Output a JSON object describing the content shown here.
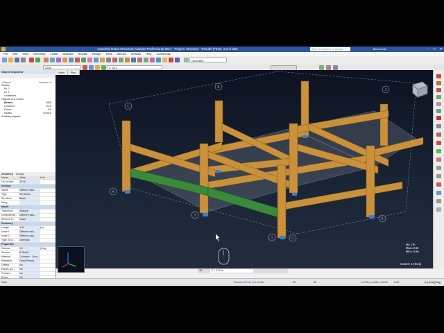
{
  "app": {
    "title": "Autodesk Robot Structural Analysis Professional 2017 - Project: Structure - Results (FEM): out of date",
    "search_placeholder": "Type a keyword or phrase",
    "user": "Benvenuto",
    "menu": [
      "File",
      "Edit",
      "View",
      "Geometry",
      "Loads",
      "Analysis",
      "Results",
      "Design",
      "Tools",
      "Add-ins",
      "Window",
      "Help",
      "Community"
    ]
  },
  "toolbar": {
    "bar_value": "2930",
    "case_value": "1: DL1",
    "layout_value": "Geometry"
  },
  "inspector": {
    "title": "Object Inspector",
    "col_objects": "Objects",
    "col_number": "Number of...",
    "tree": [
      {
        "label": "Stories",
        "count": ""
      },
      {
        "label": "Ex 2",
        "count": ""
      },
      {
        "label": "Ex 1",
        "count": ""
      },
      {
        "label": "Undefined",
        "count": ""
      },
      {
        "label": "Objects of a model",
        "count": ""
      },
      {
        "label": "Beams",
        "count": "2/12"
      },
      {
        "label": "Columns",
        "count": "0/15"
      },
      {
        "label": "Floors",
        "count": "0/4"
      },
      {
        "label": "Nodes",
        "count": "0/2015"
      },
      {
        "label": "Auxiliary objects",
        "count": ""
      }
    ],
    "tabs": [
      "Geometry",
      "Groups"
    ],
    "props_header": {
      "name": "Name",
      "value": "Value",
      "unit": "Unit"
    },
    "props": [
      {
        "name": "List of bars",
        "value": "29 30",
        "unit": "",
        "section": false
      },
      {
        "name": "General",
        "value": "",
        "unit": "",
        "section": true
      },
      {
        "name": "Name",
        "value": "Different valu...",
        "unit": "",
        "section": false
      },
      {
        "name": "Type",
        "value": "RC Beam",
        "unit": "",
        "section": false
      },
      {
        "name": "Structure...",
        "value": "Beam",
        "unit": "",
        "section": false
      },
      {
        "name": "Story",
        "value": "",
        "unit": "",
        "section": false
      },
      {
        "name": "Model",
        "value": "",
        "unit": "",
        "section": true
      },
      {
        "name": "Trapezoid...",
        "value": "Analyze",
        "unit": "",
        "section": false
      },
      {
        "name": "components...",
        "value": "Different valu...",
        "unit": "",
        "section": false
      },
      {
        "name": "Element ty...",
        "value": "beam",
        "unit": "",
        "section": false
      },
      {
        "name": "Geometry",
        "value": "",
        "unit": "",
        "section": true
      },
      {
        "name": "Length",
        "value": "5.00",
        "unit": "(m)",
        "section": false
      },
      {
        "name": "Node 1",
        "value": "Different valu...",
        "unit": "",
        "section": false
      },
      {
        "name": "Node 2",
        "value": "Different valu...",
        "unit": "",
        "section": false
      },
      {
        "name": "Type of co...",
        "value": "cartesian",
        "unit": "",
        "section": false
      },
      {
        "name": "Properties",
        "value": "",
        "unit": "",
        "section": true
      },
      {
        "name": "Gamma",
        "value": "0.0",
        "unit": "(Deg)",
        "section": false
      },
      {
        "name": "Section",
        "value": "B 30x40",
        "unit": "",
        "section": false
      },
      {
        "name": "Material",
        "value": "Concrete - Conc...",
        "unit": "",
        "section": false
      },
      {
        "name": "Releases",
        "value": "Fixed-Pinned",
        "unit": "",
        "section": false
      },
      {
        "name": "Offsets",
        "value": "No",
        "unit": "",
        "section": false
      },
      {
        "name": "Elastic gro...",
        "value": "No",
        "unit": "",
        "section": false
      },
      {
        "name": "Precam...",
        "value": "No",
        "unit": "",
        "section": false
      },
      {
        "name": "Brace...",
        "value": "No",
        "unit": "",
        "section": false
      }
    ]
  },
  "viewport": {
    "tabs": [
      "View",
      "Plan"
    ],
    "grid_labels": [
      "C",
      "B",
      "2",
      "A",
      "2",
      "1",
      "3",
      "C",
      "B"
    ],
    "legend": [
      "My  1Te",
      "Max=3.62",
      "Min=-3.55"
    ],
    "cases": "Cases: 1 (DL1)",
    "bottom_mode": "3D",
    "bottom_value": "Z = 3.25 m"
  },
  "statusbar": {
    "left": "View",
    "results": "Results (FEM): out of date",
    "num1": "29",
    "num2": "53",
    "coords": "x=7.00, y=4.00, z=0.00",
    "units": "0.00",
    "system": "[m] [kN] [Deg]"
  },
  "colors": {
    "title_bar": "#2b579a",
    "beam": "#c9913c",
    "selected_beam": "#3a8a3a",
    "support": "#3a7fd0"
  }
}
